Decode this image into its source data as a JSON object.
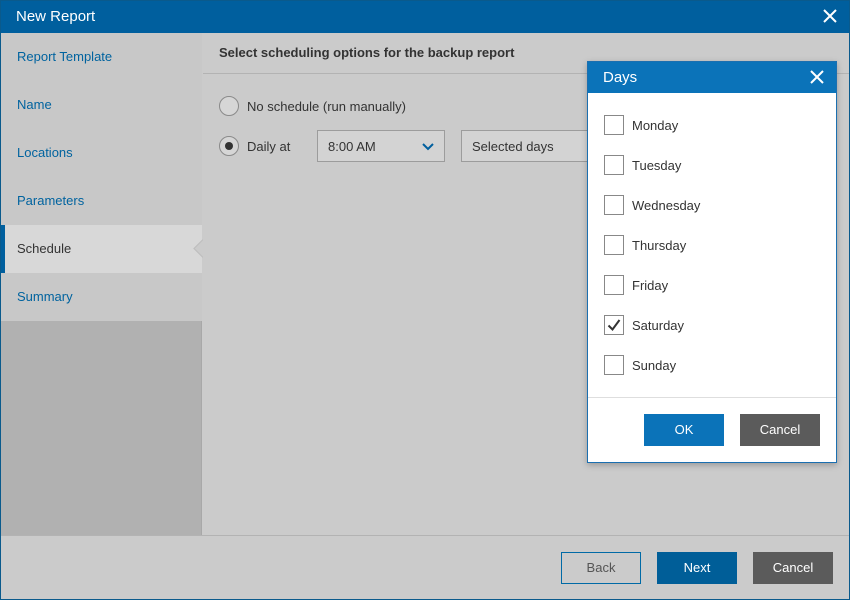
{
  "window": {
    "title": "New Report"
  },
  "sidebar": {
    "items": [
      {
        "label": "Report Template",
        "active": false
      },
      {
        "label": "Name",
        "active": false
      },
      {
        "label": "Locations",
        "active": false
      },
      {
        "label": "Parameters",
        "active": false
      },
      {
        "label": "Schedule",
        "active": true
      },
      {
        "label": "Summary",
        "active": false
      }
    ]
  },
  "main": {
    "heading": "Select scheduling options for the backup report",
    "no_schedule_label": "No schedule (run manually)",
    "daily_label": "Daily at",
    "time_value": "8:00 AM",
    "days_mode_value": "Selected days"
  },
  "footer": {
    "back": "Back",
    "next": "Next",
    "cancel": "Cancel"
  },
  "days_popup": {
    "title": "Days",
    "days": [
      {
        "label": "Monday",
        "checked": false
      },
      {
        "label": "Tuesday",
        "checked": false
      },
      {
        "label": "Wednesday",
        "checked": false
      },
      {
        "label": "Thursday",
        "checked": false
      },
      {
        "label": "Friday",
        "checked": false
      },
      {
        "label": "Saturday",
        "checked": true
      },
      {
        "label": "Sunday",
        "checked": false
      }
    ],
    "ok": "OK",
    "cancel": "Cancel"
  },
  "colors": {
    "accent": "#005f9e",
    "popup_header": "#0b73b9",
    "gray_button": "#5b5b5b"
  }
}
